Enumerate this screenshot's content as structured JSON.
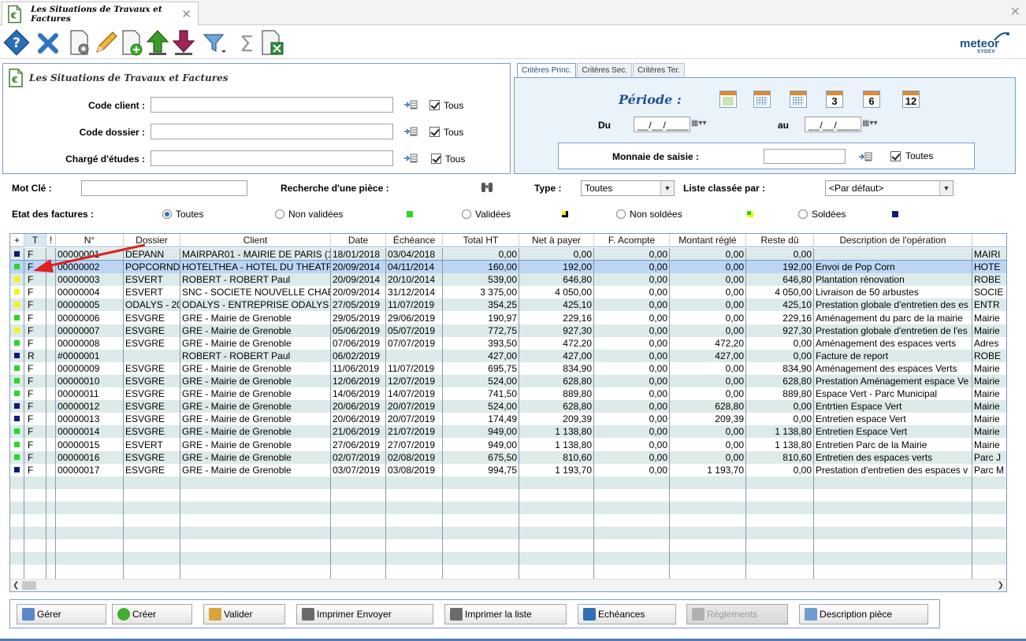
{
  "window": {
    "tab_title": "Les Situations de Travaux et Factures",
    "close_glyph": "✕"
  },
  "toolbar": {
    "icons": [
      "help-icon",
      "delete-icon",
      "settings-document-icon",
      "edit-pencil-icon",
      "new-document-icon",
      "import-up-arrow-icon",
      "export-down-arrow-icon",
      "filter-icon",
      "sum-sigma-icon",
      "excel-export-icon"
    ],
    "logo_text": "meteor",
    "logo_sub": "SYDEV"
  },
  "criteria_left": {
    "title": "Les Situations de Travaux et Factures",
    "rows": [
      {
        "label": "Code client :",
        "value": "",
        "check_label": "Tous"
      },
      {
        "label": "Code dossier :",
        "value": "",
        "check_label": "Tous"
      },
      {
        "label": "Chargé d'études :",
        "value": "",
        "check_label": "Tous"
      }
    ]
  },
  "criteria_right": {
    "tabs": [
      "Critères Princ.",
      "Critères Sec.",
      "Critères Ter."
    ],
    "periode_label": "Période :",
    "period_buttons": [
      "",
      "",
      "",
      "3",
      "6",
      "12"
    ],
    "du_label": "Du",
    "au_label": "au",
    "du_value": "__/__/____",
    "au_value": "__/__/____",
    "monnaie_label": "Monnaie de saisie :",
    "monnaie_value": "",
    "monnaie_check": "Toutes"
  },
  "search": {
    "mot_cle_label": "Mot Clé :",
    "mot_cle_value": "",
    "piece_label": "Recherche d'une pièce :",
    "type_label": "Type :",
    "type_value": "Toutes",
    "liste_label": "Liste classée par :",
    "liste_value": "<Par défaut>"
  },
  "etat": {
    "label": "Etat des factures :",
    "options": [
      {
        "label": "Toutes",
        "selected": true
      },
      {
        "label": "Non validées",
        "selected": false,
        "color": "#27d927"
      },
      {
        "label": "Validées",
        "selected": false,
        "color": "#f5f50a"
      },
      {
        "label": "Non soldées",
        "selected": false,
        "color": "#27d927"
      },
      {
        "label": "Soldées",
        "selected": false,
        "color": "#0c1a7a"
      }
    ]
  },
  "grid": {
    "columns": [
      "+",
      "T",
      "!",
      "N°",
      "Dossier",
      "Client",
      "Date",
      "Échéance",
      "Total HT",
      "Net à payer",
      "F. Acompte",
      "Montant réglé",
      "Reste dû",
      "Description de l'opération",
      ""
    ],
    "rows": [
      {
        "color": "#0c1a7a",
        "t": "F",
        "n": "00000001",
        "dossier": "DEPANN",
        "client": "MAIRPAR01 - MAIRIE DE PARIS (1e",
        "date": "18/01/2018",
        "ech": "03/04/2018",
        "ht": "0,00",
        "net": "0,00",
        "acompte": "0,00",
        "regle": "0,00",
        "reste": "0,00",
        "desc": "",
        "extra": "MAIRI"
      },
      {
        "color": "#27d927",
        "t": "F",
        "n": "00000002",
        "dossier": "POPCORND",
        "client": "HOTELTHEA - HOTEL DU THEATR",
        "date": "20/09/2014",
        "ech": "04/11/2014",
        "ht": "160,00",
        "net": "192,00",
        "acompte": "0,00",
        "regle": "0,00",
        "reste": "192,00",
        "desc": "Envoi de Pop Corn",
        "extra": "HOTE"
      },
      {
        "color": "#f5f50a",
        "t": "F",
        "n": "00000003",
        "dossier": "ESVERT",
        "client": "ROBERT - ROBERT Paul",
        "date": "20/09/2014",
        "ech": "20/10/2014",
        "ht": "539,00",
        "net": "646,80",
        "acompte": "0,00",
        "regle": "0,00",
        "reste": "646,80",
        "desc": "Plantation rénovation",
        "extra": "ROBE"
      },
      {
        "color": "#f5f50a",
        "t": "F",
        "n": "00000004",
        "dossier": "ESVERT",
        "client": "SNC - SOCIETE NOUVELLE CHAB",
        "date": "20/09/2014",
        "ech": "31/12/2014",
        "ht": "3 375,00",
        "net": "4 050,00",
        "acompte": "0,00",
        "regle": "0,00",
        "reste": "4 050,00",
        "desc": "Livraison de 50 arbustes",
        "extra": "SOCIE"
      },
      {
        "color": "#f5f50a",
        "t": "F",
        "n": "00000005",
        "dossier": "ODALYS - 20",
        "client": "ODALYS - ENTREPRISE ODALYS",
        "date": "27/05/2019",
        "ech": "11/07/2019",
        "ht": "354,25",
        "net": "425,10",
        "acompte": "0,00",
        "regle": "0,00",
        "reste": "425,10",
        "desc": "Prestation globale d'entretien des es",
        "extra": "ENTR"
      },
      {
        "color": "#27d927",
        "t": "F",
        "n": "00000006",
        "dossier": "ESVGRE",
        "client": "GRE - Mairie de Grenoble",
        "date": "29/05/2019",
        "ech": "29/06/2019",
        "ht": "190,97",
        "net": "229,16",
        "acompte": "0,00",
        "regle": "0,00",
        "reste": "229,16",
        "desc": "Aménagement du parc de la mairie",
        "extra": "Mairie"
      },
      {
        "color": "#f5f50a",
        "t": "F",
        "n": "00000007",
        "dossier": "ESVGRE",
        "client": "GRE - Mairie de Grenoble",
        "date": "05/06/2019",
        "ech": "05/07/2019",
        "ht": "772,75",
        "net": "927,30",
        "acompte": "0,00",
        "regle": "0,00",
        "reste": "927,30",
        "desc": "Prestation globale d'entretien de l'es",
        "extra": "Mairie"
      },
      {
        "color": "#27d927",
        "t": "F",
        "n": "00000008",
        "dossier": "ESVGRE",
        "client": "GRE - Mairie de Grenoble",
        "date": "07/06/2019",
        "ech": "07/07/2019",
        "ht": "393,50",
        "net": "472,20",
        "acompte": "0,00",
        "regle": "472,20",
        "reste": "0,00",
        "desc": "Aménagement des espaces verts",
        "extra": "Adres"
      },
      {
        "color": "#0c1a7a",
        "t": "R",
        "n": "#0000001",
        "dossier": "",
        "client": "ROBERT - ROBERT Paul",
        "date": "06/02/2019",
        "ech": "",
        "ht": "427,00",
        "net": "427,00",
        "acompte": "0,00",
        "regle": "427,00",
        "reste": "0,00",
        "desc": "Facture de report",
        "extra": "ROBE"
      },
      {
        "color": "#27d927",
        "t": "F",
        "n": "00000009",
        "dossier": "ESVGRE",
        "client": "GRE - Mairie de Grenoble",
        "date": "11/06/2019",
        "ech": "11/07/2019",
        "ht": "695,75",
        "net": "834,90",
        "acompte": "0,00",
        "regle": "0,00",
        "reste": "834,90",
        "desc": "Aménagement des espaces Verts",
        "extra": "Mairie"
      },
      {
        "color": "#27d927",
        "t": "F",
        "n": "00000010",
        "dossier": "ESVGRE",
        "client": "GRE - Mairie de Grenoble",
        "date": "12/06/2019",
        "ech": "12/07/2019",
        "ht": "524,00",
        "net": "628,80",
        "acompte": "0,00",
        "regle": "0,00",
        "reste": "628,80",
        "desc": "Prestation Aménagement espace Ve",
        "extra": "Mairie"
      },
      {
        "color": "#27d927",
        "t": "F",
        "n": "00000011",
        "dossier": "ESVGRE",
        "client": "GRE - Mairie de Grenoble",
        "date": "14/06/2019",
        "ech": "14/07/2019",
        "ht": "741,50",
        "net": "889,80",
        "acompte": "0,00",
        "regle": "0,00",
        "reste": "889,80",
        "desc": "Espace Vert - Parc Municipal",
        "extra": "Mairie"
      },
      {
        "color": "#0c1a7a",
        "t": "F",
        "n": "00000012",
        "dossier": "ESVGRE",
        "client": "GRE - Mairie de Grenoble",
        "date": "20/06/2019",
        "ech": "20/07/2019",
        "ht": "524,00",
        "net": "628,80",
        "acompte": "0,00",
        "regle": "628,80",
        "reste": "0,00",
        "desc": "Entrtien Espace Vert",
        "extra": "Mairie"
      },
      {
        "color": "#0c1a7a",
        "t": "F",
        "n": "00000013",
        "dossier": "ESVGRE",
        "client": "GRE - Mairie de Grenoble",
        "date": "20/06/2019",
        "ech": "20/07/2019",
        "ht": "174,49",
        "net": "209,39",
        "acompte": "0,00",
        "regle": "209,39",
        "reste": "0,00",
        "desc": "Entretien espace Vert",
        "extra": "Mairie"
      },
      {
        "color": "#27d927",
        "t": "F",
        "n": "00000014",
        "dossier": "ESVGRE",
        "client": "GRE - Mairie de Grenoble",
        "date": "21/06/2019",
        "ech": "21/07/2019",
        "ht": "949,00",
        "net": "1 138,80",
        "acompte": "0,00",
        "regle": "0,00",
        "reste": "1 138,80",
        "desc": "Entretien Espace Vert",
        "extra": "Mairie"
      },
      {
        "color": "#27d927",
        "t": "F",
        "n": "00000015",
        "dossier": "ESVERT",
        "client": "GRE - Mairie de Grenoble",
        "date": "27/06/2019",
        "ech": "27/07/2019",
        "ht": "949,00",
        "net": "1 138,80",
        "acompte": "0,00",
        "regle": "0,00",
        "reste": "1 138,80",
        "desc": "Entretien Parc de la Mairie",
        "extra": "Mairie"
      },
      {
        "color": "#27d927",
        "t": "F",
        "n": "00000016",
        "dossier": "ESVGRE",
        "client": "GRE - Mairie de Grenoble",
        "date": "02/07/2019",
        "ech": "02/08/2019",
        "ht": "675,50",
        "net": "810,60",
        "acompte": "0,00",
        "regle": "0,00",
        "reste": "810,60",
        "desc": "Entretien des espaces verts",
        "extra": "Parc J"
      },
      {
        "color": "#0c1a7a",
        "t": "F",
        "n": "00000017",
        "dossier": "ESVGRE",
        "client": "GRE - Mairie de Grenoble",
        "date": "03/07/2019",
        "ech": "03/08/2019",
        "ht": "994,75",
        "net": "1 193,70",
        "acompte": "0,00",
        "regle": "1 193,70",
        "reste": "0,00",
        "desc": "Prestation d'entretien des espaces v",
        "extra": "Parc M"
      }
    ]
  },
  "buttons": [
    {
      "label": "Gérer",
      "icon": "gear-icon",
      "enabled": true
    },
    {
      "label": "Créer",
      "icon": "add-circle-icon",
      "enabled": true
    },
    {
      "label": "Valider",
      "icon": "validate-icon",
      "enabled": true
    },
    {
      "label": "Imprimer Envoyer",
      "icon": "print-send-icon",
      "enabled": true
    },
    {
      "label": "Imprimer la liste",
      "icon": "print-list-icon",
      "enabled": true
    },
    {
      "label": "Echéances",
      "icon": "calendar-icon",
      "enabled": true
    },
    {
      "label": "Règlements",
      "icon": "payment-icon",
      "enabled": false
    },
    {
      "label": "Description pièce",
      "icon": "magnifier-icon",
      "enabled": true
    }
  ]
}
